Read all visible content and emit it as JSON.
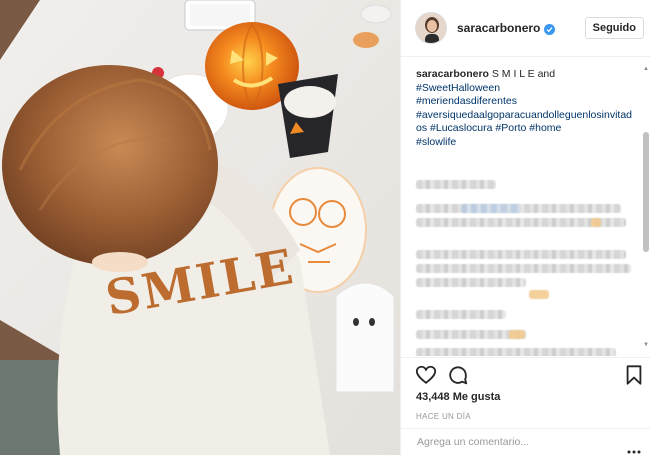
{
  "post": {
    "username": "saracarbonero",
    "follow_label": "Seguido",
    "caption_user": "saracarbonero",
    "caption_text": " S M I L E and ",
    "hashtags": [
      "#SweetHalloween",
      "#meriendasdiferentes",
      "#aversiquedaalgoparacuandolleguenlosinvitados",
      "#Lucaslocura",
      "#Porto",
      "#home",
      "#slowlife"
    ],
    "likes": "43,448 Me gusta",
    "time": "HACE UN DÍA",
    "comment_placeholder": "Agrega un comentario..."
  },
  "photo": {
    "shirt_text": "SMILE"
  },
  "icons": {
    "verified": "verified-badge-icon",
    "like": "heart-icon",
    "comment": "speech-bubble-icon",
    "save": "bookmark-icon",
    "more": "more-options-icon"
  },
  "colors": {
    "link": "#003569",
    "verified": "#3897f0",
    "border": "#efefef"
  }
}
